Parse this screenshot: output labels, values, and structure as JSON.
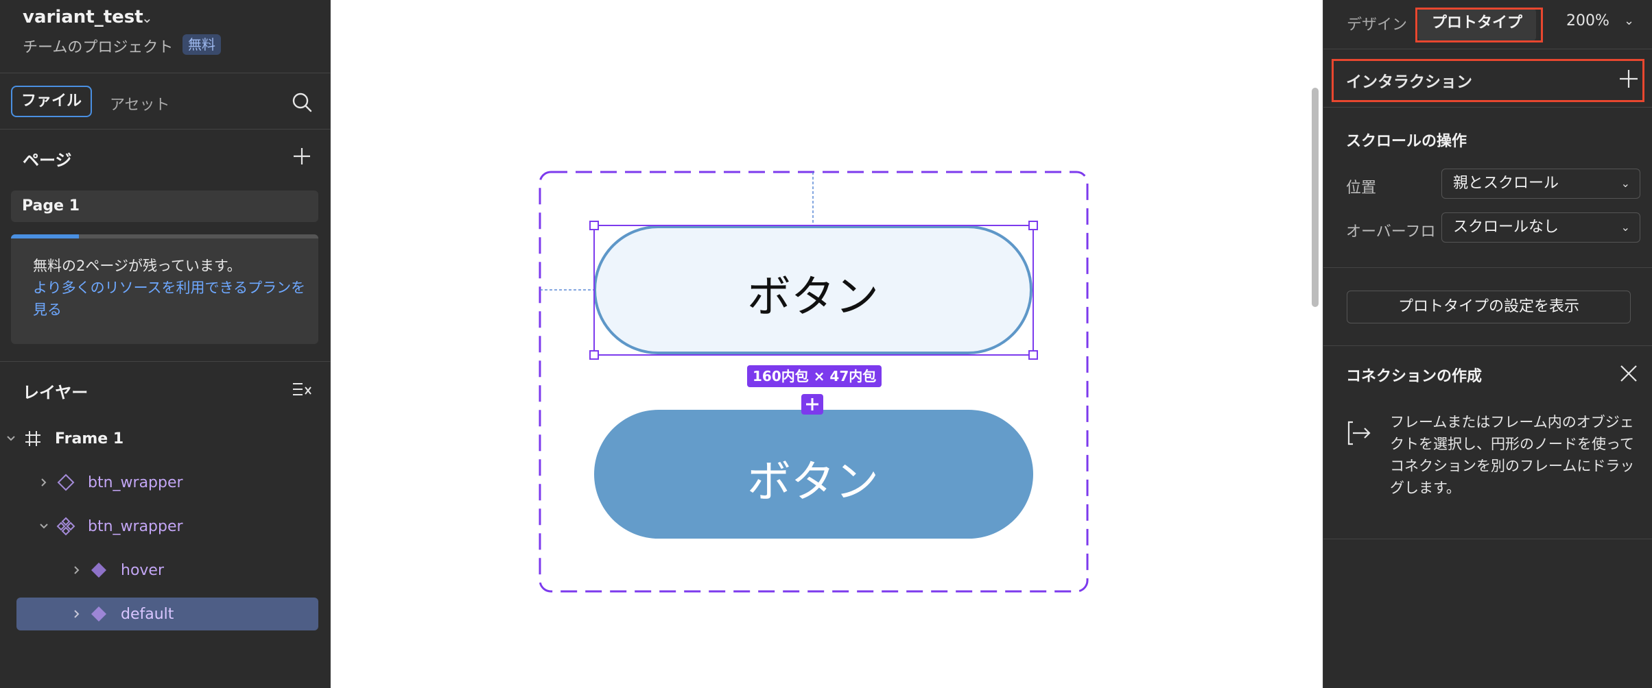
{
  "file": {
    "name": "variant_test",
    "team": "チームのプロジェクト",
    "badge": "無料"
  },
  "left_tabs": {
    "file": "ファイル",
    "assets": "アセット"
  },
  "pages": {
    "heading": "ページ",
    "items": [
      "Page 1"
    ],
    "notice": "無料の2ページが残っています。",
    "upgrade_link": "より多くのリソースを利用できるプランを見る",
    "usage_fraction": 0.22
  },
  "layers": {
    "heading": "レイヤー",
    "items": [
      {
        "label": "Frame 1",
        "icon": "frame-icon",
        "depth": 0,
        "expanded": true
      },
      {
        "label": "btn_wrapper",
        "icon": "component-outline-icon",
        "depth": 1,
        "expanded": false
      },
      {
        "label": "btn_wrapper",
        "icon": "component-set-icon",
        "depth": 1,
        "expanded": true
      },
      {
        "label": "hover",
        "icon": "variant-icon",
        "depth": 2,
        "expanded": false
      },
      {
        "label": "default",
        "icon": "variant-icon",
        "depth": 2,
        "expanded": false,
        "selected": true
      }
    ]
  },
  "canvas": {
    "button_hover_label": "ボタン",
    "button_default_label": "ボタン",
    "size_badge": "160内包 × 47内包",
    "colors": {
      "selection": "#7c3aed",
      "button_fill": "#649cca",
      "button_light_fill": "#eef5fc",
      "button_stroke": "#5e97c8"
    }
  },
  "right_panel": {
    "tabs": {
      "design": "デザイン",
      "prototype": "プロトタイプ"
    },
    "zoom": "200%",
    "interaction": "インタラクション",
    "scroll_section": {
      "heading": "スクロールの操作",
      "position_label": "位置",
      "position_value": "親とスクロール",
      "overflow_label": "オーバーフロ",
      "overflow_value": "スクロールなし"
    },
    "settings_button": "プロトタイプの設定を表示",
    "connection": {
      "heading": "コネクションの作成",
      "description": "フレームまたはフレーム内のオブジェクトを選択し、円形のノードを使ってコネクションを別のフレームにドラッグします。"
    },
    "highlight_color": "#e8472f"
  }
}
